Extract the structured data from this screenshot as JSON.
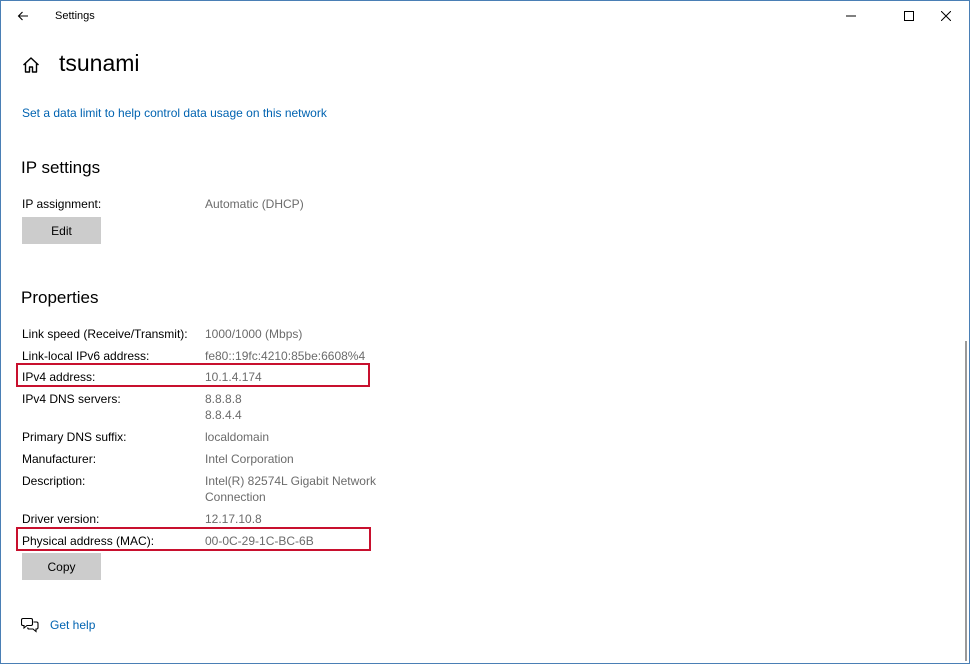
{
  "window": {
    "title": "Settings"
  },
  "page": {
    "title": "tsunami"
  },
  "data_limit_link": "Set a data limit to help control data usage on this network",
  "ip_settings": {
    "heading": "IP settings",
    "assignment_label": "IP assignment:",
    "assignment_value": "Automatic (DHCP)",
    "edit_label": "Edit"
  },
  "properties": {
    "heading": "Properties",
    "rows": [
      {
        "label": "Link speed (Receive/Transmit):",
        "value": "1000/1000 (Mbps)"
      },
      {
        "label": "Link-local IPv6 address:",
        "value": "fe80::19fc:4210:85be:6608%4"
      },
      {
        "label": "IPv4 address:",
        "value": "10.1.4.174"
      },
      {
        "label": "IPv4 DNS servers:",
        "value": "8.8.8.8",
        "value2": "8.8.4.4"
      },
      {
        "label": "Primary DNS suffix:",
        "value": "localdomain"
      },
      {
        "label": "Manufacturer:",
        "value": "Intel Corporation"
      },
      {
        "label": "Description:",
        "value": "Intel(R) 82574L Gigabit Network",
        "value2": "Connection"
      },
      {
        "label": "Driver version:",
        "value": "12.17.10.8"
      },
      {
        "label": "Physical address (MAC):",
        "value": "00-0C-29-1C-BC-6B"
      }
    ],
    "copy_label": "Copy"
  },
  "help": {
    "label": "Get help"
  },
  "colors": {
    "link": "#0063b1",
    "highlight": "#c8102e",
    "button": "#cccccc",
    "value_text": "#6b6b6b"
  },
  "icons": {
    "back": "arrow-left-icon",
    "minimize": "minimize-icon",
    "maximize": "maximize-icon",
    "close": "close-icon",
    "home": "home-icon",
    "help": "chat-help-icon"
  }
}
